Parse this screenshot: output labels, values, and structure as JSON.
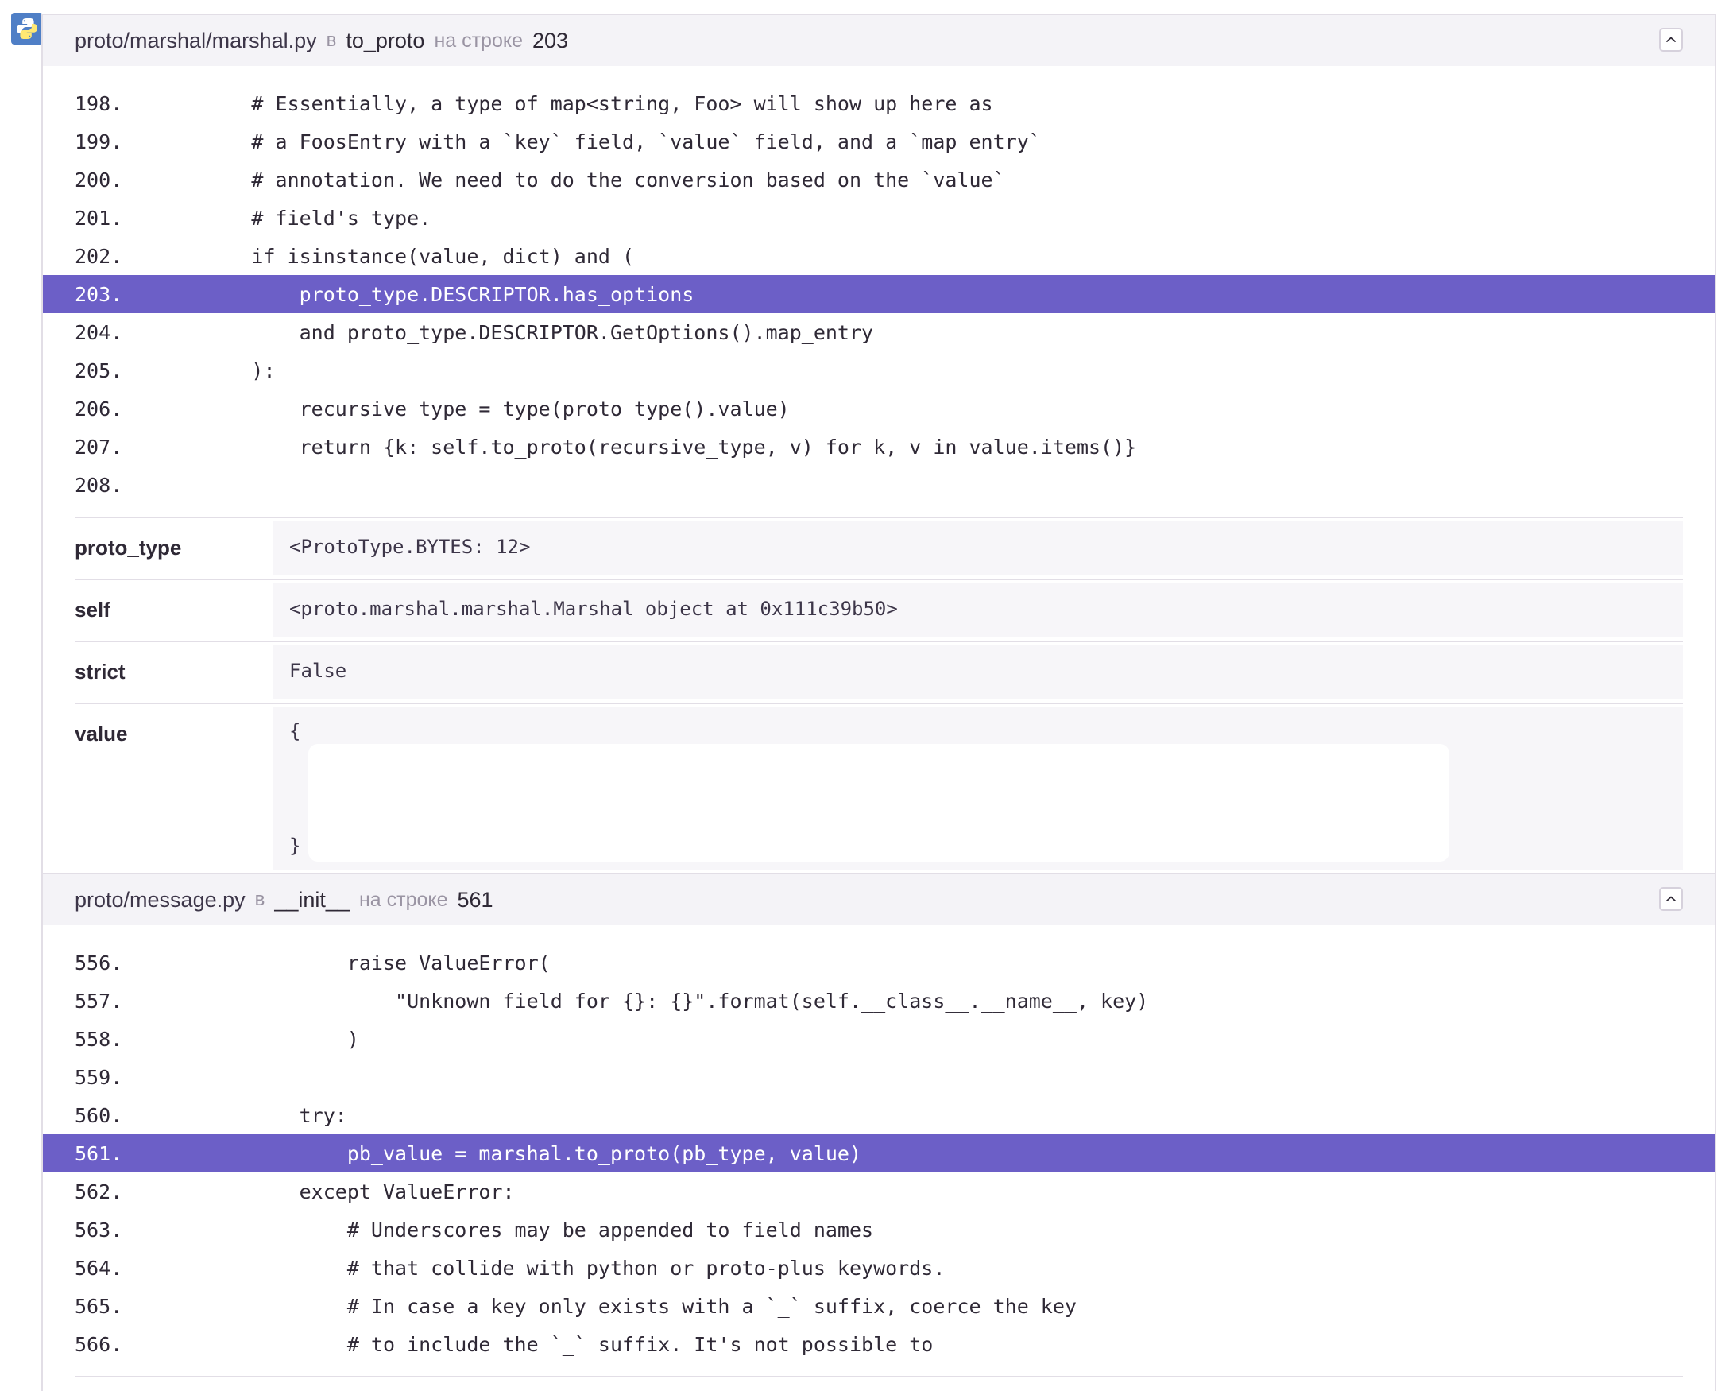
{
  "frames": [
    {
      "file": "proto/marshal/marshal.py",
      "in_word": "в",
      "function": "to_proto",
      "on_line_word": "на строке",
      "line": "203",
      "lines": [
        {
          "no": "198.",
          "code": "        # Essentially, a type of map<string, Foo> will show up here as"
        },
        {
          "no": "199.",
          "code": "        # a FoosEntry with a `key` field, `value` field, and a `map_entry`"
        },
        {
          "no": "200.",
          "code": "        # annotation. We need to do the conversion based on the `value`"
        },
        {
          "no": "201.",
          "code": "        # field's type."
        },
        {
          "no": "202.",
          "code": "        if isinstance(value, dict) and ("
        },
        {
          "no": "203.",
          "code": "            proto_type.DESCRIPTOR.has_options"
        },
        {
          "no": "204.",
          "code": "            and proto_type.DESCRIPTOR.GetOptions().map_entry"
        },
        {
          "no": "205.",
          "code": "        ):"
        },
        {
          "no": "206.",
          "code": "            recursive_type = type(proto_type().value)"
        },
        {
          "no": "207.",
          "code": "            return {k: self.to_proto(recursive_type, v) for k, v in value.items()}"
        },
        {
          "no": "208.",
          "code": ""
        }
      ],
      "vars": [
        {
          "name": "proto_type",
          "value": "<ProtoType.BYTES: 12>"
        },
        {
          "name": "self",
          "value": "<proto.marshal.marshal.Marshal object at 0x111c39b50>"
        },
        {
          "name": "strict",
          "value": "False"
        },
        {
          "name": "value",
          "open": "{",
          "close": "}"
        }
      ]
    },
    {
      "file": "proto/message.py",
      "in_word": "в",
      "function": "__init__",
      "on_line_word": "на строке",
      "line": "561",
      "lines": [
        {
          "no": "556.",
          "code": "                raise ValueError("
        },
        {
          "no": "557.",
          "code": "                    \"Unknown field for {}: {}\".format(self.__class__.__name__, key)"
        },
        {
          "no": "558.",
          "code": "                )"
        },
        {
          "no": "559.",
          "code": ""
        },
        {
          "no": "560.",
          "code": "            try:"
        },
        {
          "no": "561.",
          "code": "                pb_value = marshal.to_proto(pb_type, value)"
        },
        {
          "no": "562.",
          "code": "            except ValueError:"
        },
        {
          "no": "563.",
          "code": "                # Underscores may be appended to field names"
        },
        {
          "no": "564.",
          "code": "                # that collide with python or proto-plus keywords."
        },
        {
          "no": "565.",
          "code": "                # In case a key only exists with a `_` suffix, coerce the key"
        },
        {
          "no": "566.",
          "code": "                # to include the `_` suffix. It's not possible to"
        }
      ]
    }
  ],
  "colors": {
    "highlight": "#6c5fc7",
    "header_bg": "#f4f3f7",
    "python_badge": "#4f7fc6"
  },
  "icons": {
    "platform": "python-icon",
    "collapse": "chevron-up-icon"
  }
}
